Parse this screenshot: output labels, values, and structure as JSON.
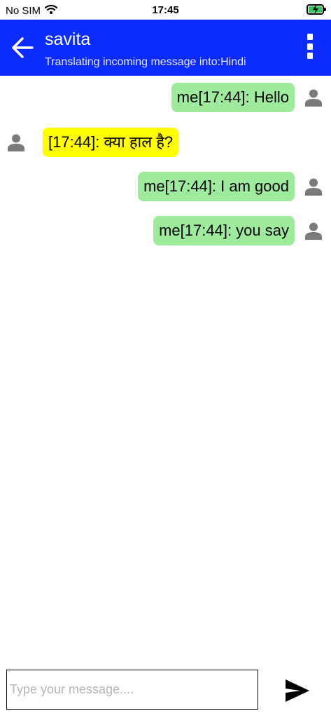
{
  "status_bar": {
    "carrier": "No SIM",
    "time": "17:45",
    "wifi_icon": "wifi-icon",
    "battery_icon": "battery-charging-icon"
  },
  "header": {
    "back_icon": "arrow-left-icon",
    "name": "savita",
    "subtitle": "Translating incoming message into:Hindi",
    "menu_icon": "more-vertical-icon",
    "background_color": "#0c2bff"
  },
  "messages": [
    {
      "direction": "out",
      "text": "me[17:44]: Hello"
    },
    {
      "direction": "in",
      "text": "[17:44]: क्या हाल है?"
    },
    {
      "direction": "out",
      "text": "me[17:44]: I am good"
    },
    {
      "direction": "out",
      "text": "me[17:44]: you say"
    }
  ],
  "composer": {
    "placeholder": "Type your message....",
    "value": "",
    "send_icon": "send-icon"
  },
  "colors": {
    "outgoing_bubble": "#9eeb9e",
    "incoming_bubble": "#ffff00",
    "avatar": "#7a7a7a"
  }
}
